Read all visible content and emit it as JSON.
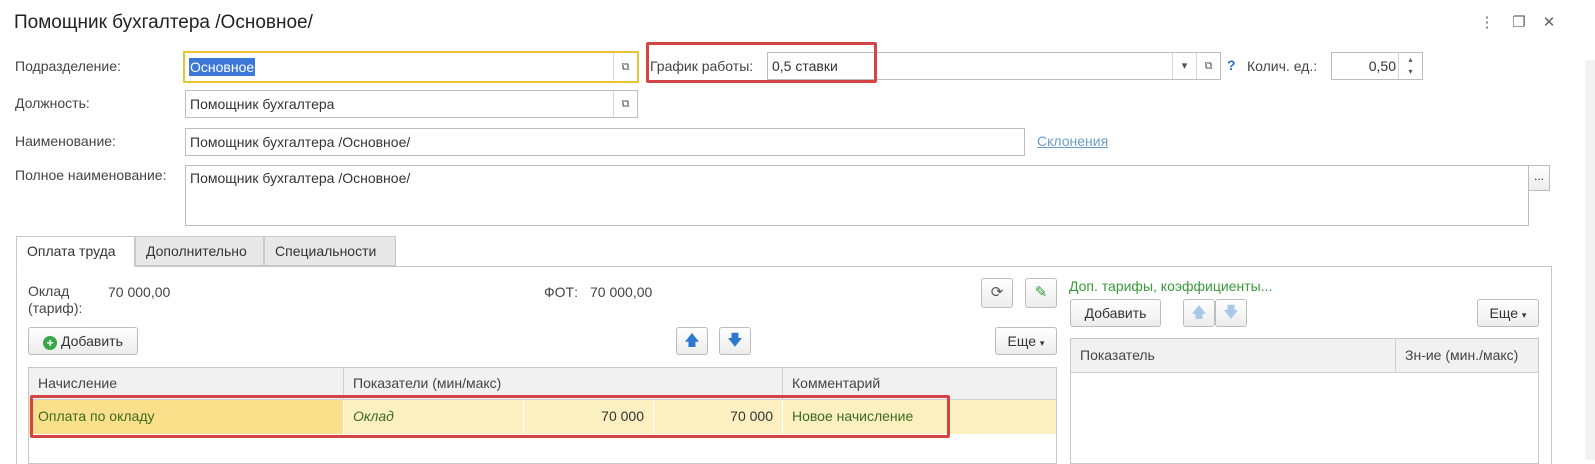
{
  "window": {
    "title": "Помощник бухгалтера /Основное/",
    "menu_icon": "more-vertical-icon",
    "restore_icon": "restore-window-icon",
    "close_icon": "close-icon"
  },
  "form": {
    "division": {
      "label": "Подразделение:",
      "value": "Основное"
    },
    "schedule": {
      "label": "График работы:",
      "value": "0,5 ставки",
      "help": "?"
    },
    "quantity": {
      "label": "Колич. ед.:",
      "value": "0,50"
    },
    "position": {
      "label": "Должность:",
      "value": "Помощник бухгалтера"
    },
    "name": {
      "label": "Наименование:",
      "value": "Помощник бухгалтера /Основное/",
      "link": "Склонения"
    },
    "full_name": {
      "label": "Полное наименование:",
      "value": "Помощник бухгалтера /Основное/",
      "ellipsis": "..."
    }
  },
  "tabs": [
    {
      "label": "Оплата труда",
      "active": true
    },
    {
      "label": "Дополнительно",
      "active": false
    },
    {
      "label": "Специальности",
      "active": false
    }
  ],
  "salary": {
    "oklad_label_1": "Оклад",
    "oklad_label_2": "(тариф):",
    "oklad_value": "70 000,00",
    "fot_label": "ФОТ:",
    "fot_value": "70 000,00"
  },
  "toolbar": {
    "add_label": "Добавить",
    "more_label": "Еще"
  },
  "accruals_table": {
    "columns": [
      "Начисление",
      "Показатели (мин/макс)",
      "Комментарий"
    ],
    "rows": [
      {
        "accrual": "Оплата по окладу",
        "indicator": "Оклад",
        "min": "70 000",
        "max": "70 000",
        "comment": "Новое начисление"
      }
    ]
  },
  "right_panel": {
    "title": "Доп. тарифы, коэффициенты...",
    "add_label": "Добавить",
    "more_label": "Еще",
    "columns": [
      "Показатель",
      "Зн-ие (мин./макс)"
    ]
  },
  "colors": {
    "selection": "#3c78d8",
    "highlight_box": "#d34545",
    "row_bg": "#fcefc0",
    "focus_border": "#e8c430",
    "green_text": "#3a9a3a"
  }
}
